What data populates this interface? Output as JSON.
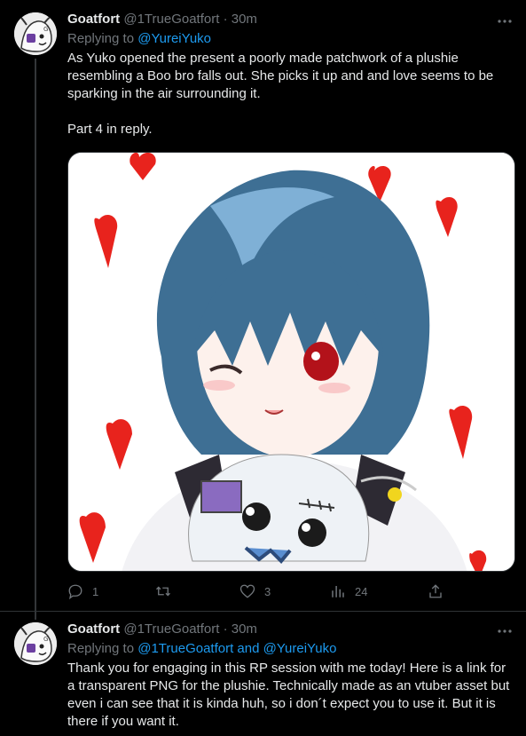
{
  "tweets": [
    {
      "author_name": "Goatfort",
      "handle": "@1TrueGoatfort",
      "separator": "·",
      "time": "30m",
      "replying_label": "Replying to",
      "replying_to": "@YureiYuko",
      "paragraph1": "As Yuko opened the present a poorly made patchwork of a plushie resembling a Boo bro falls out. She picks it up and and love seems to be sparking in the air surrounding it.",
      "paragraph2": "Part 4 in reply.",
      "replies": "1",
      "retweets": "",
      "likes": "3",
      "views": "24"
    },
    {
      "author_name": "Goatfort",
      "handle": "@1TrueGoatfort",
      "separator": "·",
      "time": "30m",
      "replying_label": "Replying to",
      "replying_to": "@1TrueGoatfort and @YureiYuko",
      "paragraph1": "Thank you for engaging in this RP session with me today! Here is a link for a transparent PNG for the plushie. Technically made as an vtuber asset but even i can see that it is kinda huh, so i don´t expect you to use it. But it is there if you want it."
    }
  ],
  "colors": {
    "background": "#000000",
    "text": "#e7e9ea",
    "muted": "#71767b",
    "link": "#1d9bf0",
    "divider": "#2f3336"
  },
  "icons": {
    "more": "more-dots-icon",
    "reply": "reply-icon",
    "retweet": "retweet-icon",
    "like": "heart-icon",
    "views": "views-icon",
    "share": "share-icon"
  }
}
